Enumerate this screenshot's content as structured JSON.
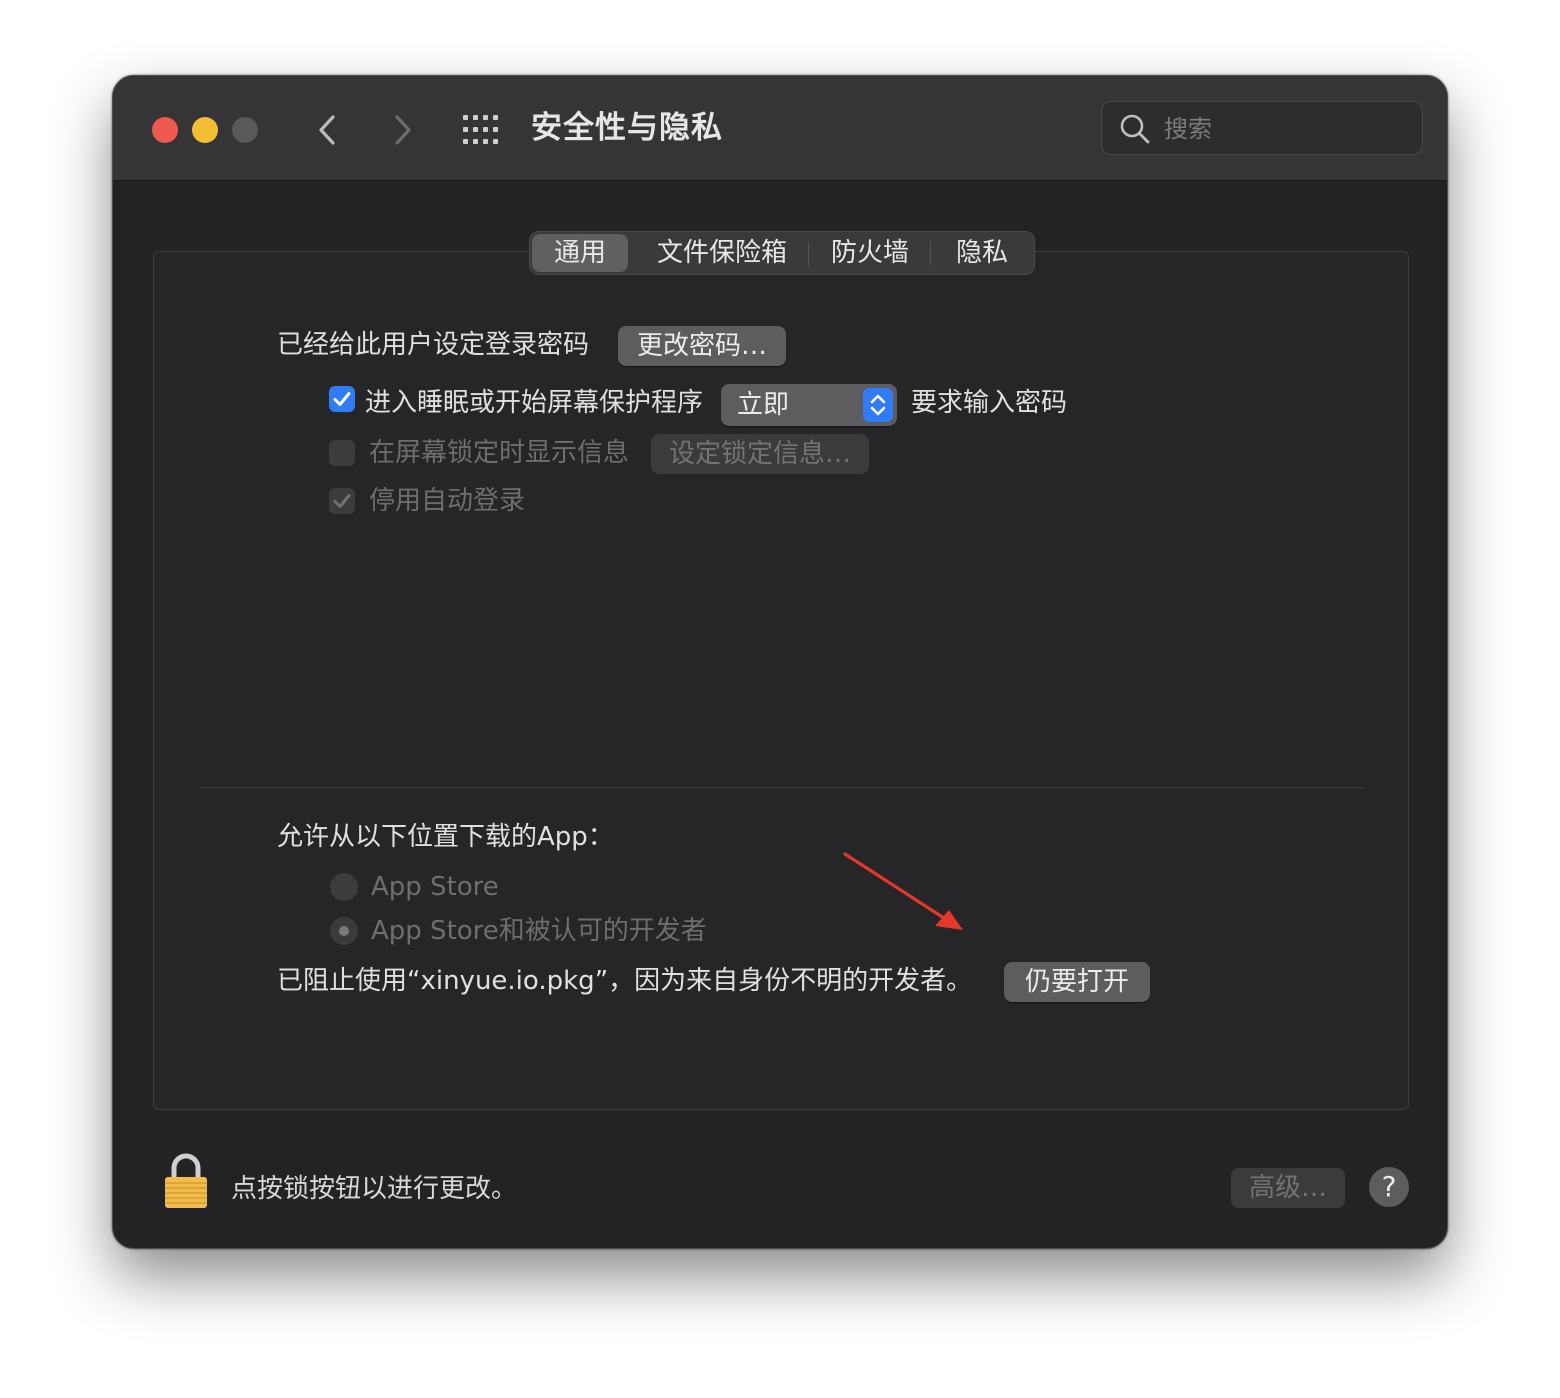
{
  "window": {
    "title": "安全性与隐私"
  },
  "search": {
    "placeholder": "搜索"
  },
  "tabs": [
    {
      "label": "通用",
      "active": true
    },
    {
      "label": "文件保险箱",
      "active": false
    },
    {
      "label": "防火墙",
      "active": false
    },
    {
      "label": "隐私",
      "active": false
    }
  ],
  "general": {
    "password_label": "已经给此用户设定登录密码",
    "change_password_button": "更改密码…",
    "require_password": {
      "checked": true,
      "label": "进入睡眠或开始屏幕保护程序",
      "popup_value": "立即",
      "suffix": "要求输入密码"
    },
    "show_message": {
      "checked": false,
      "enabled": false,
      "label": "在屏幕锁定时显示信息",
      "button": "设定锁定信息…"
    },
    "disable_auto_login": {
      "checked": true,
      "enabled": false,
      "label": "停用自动登录"
    }
  },
  "downloads": {
    "heading": "允许从以下位置下载的App：",
    "options": [
      {
        "label": "App Store",
        "selected": false
      },
      {
        "label": "App Store和被认可的开发者",
        "selected": true
      }
    ],
    "blocked_message": "已阻止使用“xinyue.io.pkg”，因为来自身份不明的开发者。",
    "open_anyway_button": "仍要打开"
  },
  "footer": {
    "lock_message": "点按锁按钮以进行更改。",
    "advanced_button": "高级…",
    "help_button": "?"
  },
  "colors": {
    "accent": "#2f7cf6",
    "annotation_arrow": "#e5372b",
    "window_bg": "#232224",
    "titlebar_bg": "#353437"
  }
}
